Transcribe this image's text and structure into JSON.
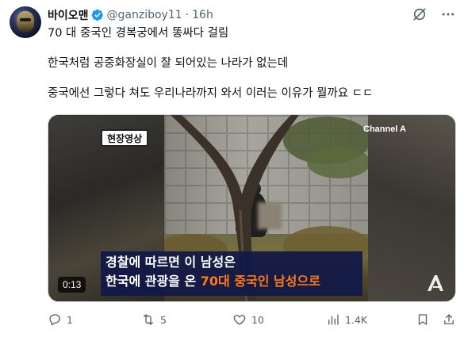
{
  "author": {
    "display_name": "바이오맨",
    "handle": "@ganziboy11",
    "separator": "·",
    "time": "16h"
  },
  "post": {
    "line1": "70 대 중국인 경복궁에서 똥싸다 걸림",
    "line2": "한국처럼 공중화장실이 잘 되어있는 나라가 없는데",
    "line3": "중국에선 그렇다 쳐도 우리나라까지 와서 이러는 이유가 뭘까요 ㄷㄷ"
  },
  "media": {
    "badge": "현장영상",
    "channel": "Channel A",
    "caption_line1": "경찰에 따르면 이 남성은",
    "caption_line2_a": "한국에 관광을 온 ",
    "caption_line2_b": "70대 중국인 남성으로",
    "duration": "0:13",
    "highlight_color": "#ff7a1a",
    "caption_bg": "#101846"
  },
  "actions": {
    "replies": "1",
    "reposts": "5",
    "likes": "10",
    "views": "1.4K"
  },
  "icons": {
    "verified": "verified-badge-icon",
    "grok": "grok-icon",
    "more": "more-icon",
    "reply": "reply-icon",
    "repost": "repost-icon",
    "like": "heart-icon",
    "views": "views-icon",
    "bookmark": "bookmark-icon",
    "share": "share-icon"
  },
  "colors": {
    "text": "#0f1419",
    "secondary": "#536471",
    "verified": "#1d9bf0"
  }
}
